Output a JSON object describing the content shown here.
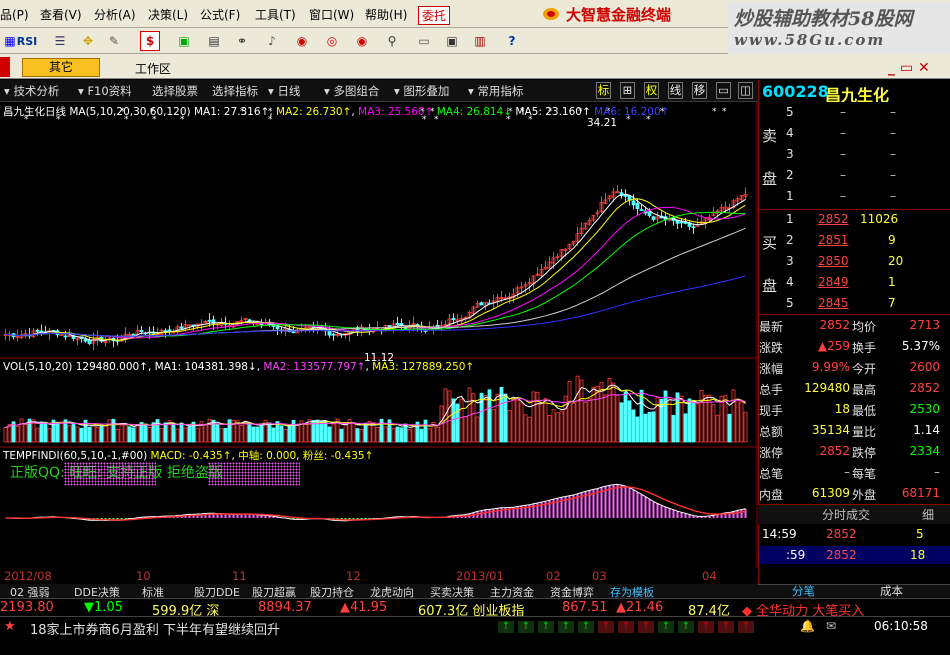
{
  "menu": {
    "items": [
      "品(P)",
      "查看(V)",
      "分析(A)",
      "决策(L)",
      "公式(F)",
      "工具(T)",
      "窗口(W)",
      "帮助(H)"
    ],
    "trade": "委托",
    "brand": "大智慧金融终端"
  },
  "watermark": {
    "line1": "炒股辅助教材58股网",
    "line2": "www.58Gu.com"
  },
  "toolbar": {
    "rsi": "RSI"
  },
  "tabs": {
    "other": "其它",
    "workarea": "工作区",
    "winctrl": "_ ▭ ✕"
  },
  "chart_toolbar": {
    "items": [
      "技术分析",
      "F10资料",
      "选择股票",
      "选择指标",
      "日线",
      "多图组合",
      "图形叠加",
      "常用指标"
    ],
    "small": [
      "标",
      "⊞",
      "权",
      "线",
      "移",
      "▭",
      "◫"
    ]
  },
  "stock": {
    "code": "600228",
    "name": "昌九生化"
  },
  "price_chart": {
    "name_label": "昌九生化日线",
    "ma_header": "MA(5,10,20,30,60,120)",
    "ma": [
      {
        "label": "MA1: 27.316↑",
        "color": "#ffffff"
      },
      {
        "label": "MA2: 26.730↑",
        "color": "#ffff00"
      },
      {
        "label": "MA3: 25.560↑",
        "color": "#ff00ff"
      },
      {
        "label": "MA4: 26.814↓",
        "color": "#00ff00"
      },
      {
        "label": "MA5: 23.160↑",
        "color": "#ffffff"
      },
      {
        "label": "MA6: 16.200↑",
        "color": "#4040ff"
      }
    ],
    "high_label": "34.21",
    "low_label": "11.12"
  },
  "vol_chart": {
    "label": "VOL(5,10,20) 129480.000↑",
    "ma1": "MA1: 104381.398↓",
    "ma2": "MA2: 133577.797↑",
    "ma3": "MA3: 127889.250↑"
  },
  "macd_chart": {
    "label": "TEMPFINDI(60,5,10,-1,#00)",
    "macd": "MACD: -0.435↑",
    "mid": "中轴: 0.000",
    "fine": "粉丝: -0.435↑",
    "promo": "正版QQ:              旺旺:              支持正版 拒绝盗版"
  },
  "dates": [
    "2012/08",
    "10",
    "11",
    "12",
    "2013/01",
    "02",
    "03",
    "04"
  ],
  "quotes": {
    "sell": [
      {
        "n": "5",
        "p": "–",
        "v": "–"
      },
      {
        "n": "4",
        "p": "–",
        "v": "–"
      },
      {
        "n": "3",
        "p": "–",
        "v": "–"
      },
      {
        "n": "2",
        "p": "–",
        "v": "–"
      },
      {
        "n": "1",
        "p": "–",
        "v": "–"
      }
    ],
    "buy": [
      {
        "n": "1",
        "p": "2852",
        "v": "11026"
      },
      {
        "n": "2",
        "p": "2851",
        "v": "9"
      },
      {
        "n": "3",
        "p": "2850",
        "v": "20"
      },
      {
        "n": "4",
        "p": "2849",
        "v": "1"
      },
      {
        "n": "5",
        "p": "2845",
        "v": "7"
      }
    ],
    "sell_label": [
      "卖",
      "盘"
    ],
    "buy_label": [
      "买",
      "盘"
    ]
  },
  "stats": [
    {
      "k1": "最新",
      "v1": "2852",
      "k2": "均价",
      "v2": "2713"
    },
    {
      "k1": "涨跌",
      "v1": "▲259",
      "k2": "换手",
      "v2": "5.37%"
    },
    {
      "k1": "涨幅",
      "v1": "9.99%",
      "k2": "今开",
      "v2": "2600"
    },
    {
      "k1": "总手",
      "v1": "129480",
      "k2": "最高",
      "v2": "2852"
    },
    {
      "k1": "现手",
      "v1": "18",
      "k2": "最低",
      "v2": "2530"
    },
    {
      "k1": "总额",
      "v1": "35134",
      "k2": "量比",
      "v2": "1.14"
    },
    {
      "k1": "涨停",
      "v1": "2852",
      "k2": "跌停",
      "v2": "2334"
    },
    {
      "k1": "总笔",
      "v1": "–",
      "k2": "每笔",
      "v2": "–"
    },
    {
      "k1": "内盘",
      "v1": "61309",
      "k2": "外盘",
      "v2": "68171"
    }
  ],
  "ticks": {
    "header": "分时成交",
    "detail": "细",
    "rows": [
      {
        "t": "14:59",
        "p": "2852",
        "v": "5"
      },
      {
        "t": ":59",
        "p": "2852",
        "v": "18"
      }
    ],
    "tabs": [
      "分笔",
      "成本"
    ]
  },
  "bottom_tabs": [
    "02 强弱",
    "DDE决策",
    "标准",
    "股刀DDE",
    "股刀超赢",
    "股刀持仓",
    "龙虎动向",
    "买卖决策",
    "主力资金",
    "资金博弈",
    "存为模板"
  ],
  "ticker": {
    "items": [
      {
        "text": "2193.80",
        "color": "#ff4040"
      },
      {
        "text": "▼1.05",
        "color": "#00ff00"
      },
      {
        "text": "599.9亿 深",
        "color": "#ffff60"
      },
      {
        "text": "8894.37",
        "color": "#ff4040"
      },
      {
        "text": "▲41.95",
        "color": "#ff4040"
      },
      {
        "text": "607.3亿 创业板指",
        "color": "#ffff60"
      },
      {
        "text": "867.51",
        "color": "#ff4040"
      },
      {
        "text": "▲21.46",
        "color": "#ff4040"
      },
      {
        "text": "87.4亿",
        "color": "#ffff60"
      },
      {
        "text": "◆ 全华动力 大笔买入",
        "color": "#ff3030"
      }
    ]
  },
  "status": {
    "news": "18家上市券商6月盈利  下半年有望继续回升",
    "time": "06:10:58"
  }
}
